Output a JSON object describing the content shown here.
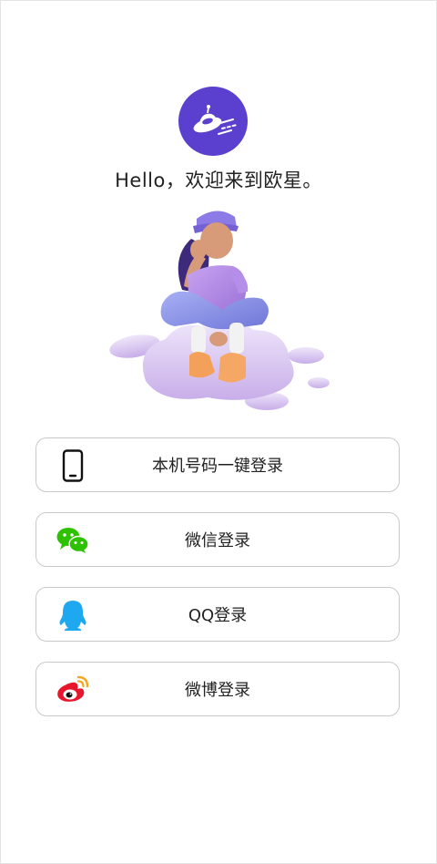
{
  "header": {
    "greeting": "Hello，欢迎来到欧星。"
  },
  "logo": {
    "icon": "planet-rocket-icon",
    "color": "#5b3fcf"
  },
  "illustration": {
    "icon": "person-sitting-on-cloud-illustration"
  },
  "login_options": [
    {
      "label": "本机号码一键登录",
      "icon": "phone-icon"
    },
    {
      "label": "微信登录",
      "icon": "wechat-icon",
      "color": "#2dc100"
    },
    {
      "label": "QQ登录",
      "icon": "qq-icon",
      "color": "#1ea8f0"
    },
    {
      "label": "微博登录",
      "icon": "weibo-icon",
      "color": "#e6162d"
    }
  ]
}
